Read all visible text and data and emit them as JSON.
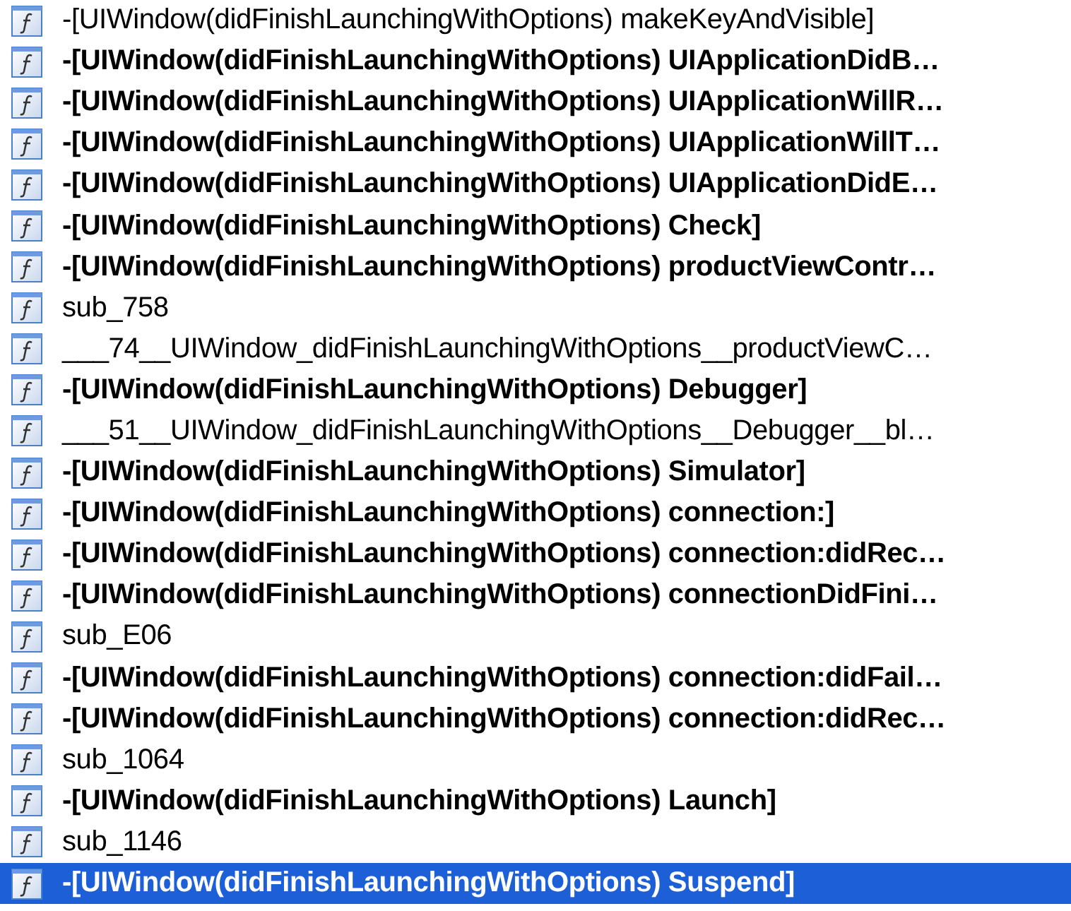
{
  "functions": [
    {
      "name": "-[UIWindow(didFinishLaunchingWithOptions) makeKeyAndVisible]",
      "bold": false,
      "selected": false
    },
    {
      "name": "-[UIWindow(didFinishLaunchingWithOptions) UIApplicationDidB…",
      "bold": true,
      "selected": false
    },
    {
      "name": "-[UIWindow(didFinishLaunchingWithOptions) UIApplicationWillR…",
      "bold": true,
      "selected": false
    },
    {
      "name": "-[UIWindow(didFinishLaunchingWithOptions) UIApplicationWillT…",
      "bold": true,
      "selected": false
    },
    {
      "name": "-[UIWindow(didFinishLaunchingWithOptions) UIApplicationDidE…",
      "bold": true,
      "selected": false
    },
    {
      "name": "-[UIWindow(didFinishLaunchingWithOptions) Check]",
      "bold": true,
      "selected": false
    },
    {
      "name": "-[UIWindow(didFinishLaunchingWithOptions) productViewContr…",
      "bold": true,
      "selected": false
    },
    {
      "name": "sub_758",
      "bold": false,
      "selected": false
    },
    {
      "name": "___74__UIWindow_didFinishLaunchingWithOptions__productViewC…",
      "bold": false,
      "selected": false
    },
    {
      "name": "-[UIWindow(didFinishLaunchingWithOptions) Debugger]",
      "bold": true,
      "selected": false
    },
    {
      "name": "___51__UIWindow_didFinishLaunchingWithOptions__Debugger__bl…",
      "bold": false,
      "selected": false
    },
    {
      "name": "-[UIWindow(didFinishLaunchingWithOptions) Simulator]",
      "bold": true,
      "selected": false
    },
    {
      "name": "-[UIWindow(didFinishLaunchingWithOptions) connection:]",
      "bold": true,
      "selected": false
    },
    {
      "name": "-[UIWindow(didFinishLaunchingWithOptions) connection:didRec…",
      "bold": true,
      "selected": false
    },
    {
      "name": "-[UIWindow(didFinishLaunchingWithOptions) connectionDidFini…",
      "bold": true,
      "selected": false
    },
    {
      "name": "sub_E06",
      "bold": false,
      "selected": false
    },
    {
      "name": "-[UIWindow(didFinishLaunchingWithOptions) connection:didFail…",
      "bold": true,
      "selected": false
    },
    {
      "name": "-[UIWindow(didFinishLaunchingWithOptions) connection:didRec…",
      "bold": true,
      "selected": false
    },
    {
      "name": "sub_1064",
      "bold": false,
      "selected": false
    },
    {
      "name": "-[UIWindow(didFinishLaunchingWithOptions) Launch]",
      "bold": true,
      "selected": false
    },
    {
      "name": "sub_1146",
      "bold": false,
      "selected": false
    },
    {
      "name": "-[UIWindow(didFinishLaunchingWithOptions) Suspend]",
      "bold": true,
      "selected": true
    }
  ]
}
